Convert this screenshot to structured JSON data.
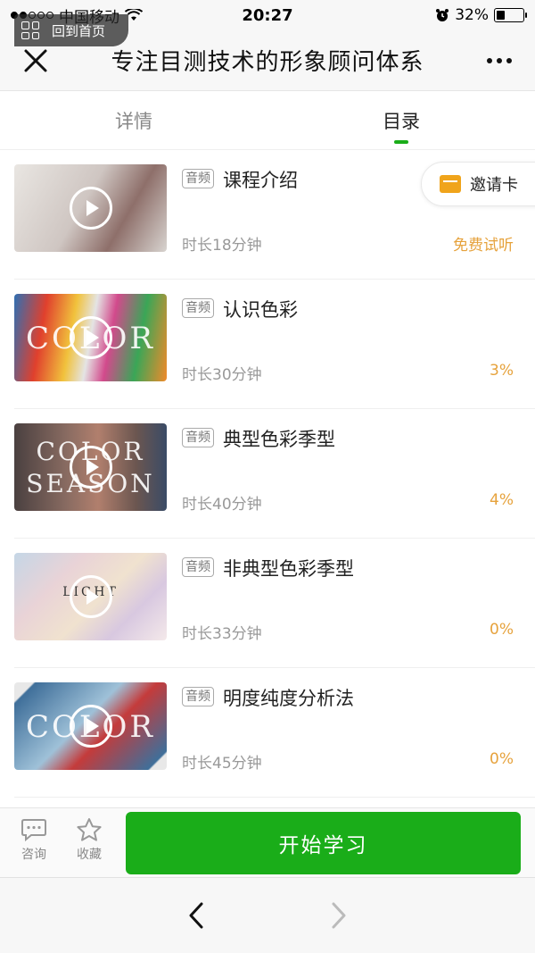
{
  "status_bar": {
    "carrier": "中国移动",
    "time": "20:27",
    "battery": "32%"
  },
  "header": {
    "title": "专注目测技术的形象顾问体系"
  },
  "tabs": [
    {
      "label": "详情",
      "active": false
    },
    {
      "label": "目录",
      "active": true
    }
  ],
  "overlay": {
    "home_label": "回到首页",
    "invite_label": "邀请卡"
  },
  "lessons": [
    {
      "badge": "音频",
      "title": "课程介绍",
      "duration": "时长18分钟",
      "status": "免费试听",
      "thumb_text": "",
      "thumb_colors": [
        "#d8d4d0",
        "#b9b0ab",
        "#8e6f6a"
      ]
    },
    {
      "badge": "音频",
      "title": "认识色彩",
      "duration": "时长30分钟",
      "status": "3%",
      "thumb_text": "COLOR",
      "thumb_colors": [
        "#e0402d",
        "#2f6fb3",
        "#f1c23c"
      ]
    },
    {
      "badge": "音频",
      "title": "典型色彩季型",
      "duration": "时长40分钟",
      "status": "4%",
      "thumb_text": "COLOR SEASON",
      "thumb_colors": [
        "#6b5650",
        "#b17f6d",
        "#4a4040"
      ]
    },
    {
      "badge": "音频",
      "title": "非典型色彩季型",
      "duration": "时长33分钟",
      "status": "0%",
      "thumb_text": "LIGHT",
      "thumb_colors": [
        "#e9d3d7",
        "#c5d6e6",
        "#f0e2cf"
      ]
    },
    {
      "badge": "音频",
      "title": "明度纯度分析法",
      "duration": "时长45分钟",
      "status": "0%",
      "thumb_text": "COLOR",
      "thumb_colors": [
        "#3f6f9a",
        "#c43b3b",
        "#9fc1d8"
      ]
    }
  ],
  "actions": {
    "consult_label": "咨询",
    "favorite_label": "收藏",
    "start_label": "开始学习"
  },
  "colors": {
    "accent_green": "#1aad19",
    "progress_orange": "#e6a23c"
  }
}
